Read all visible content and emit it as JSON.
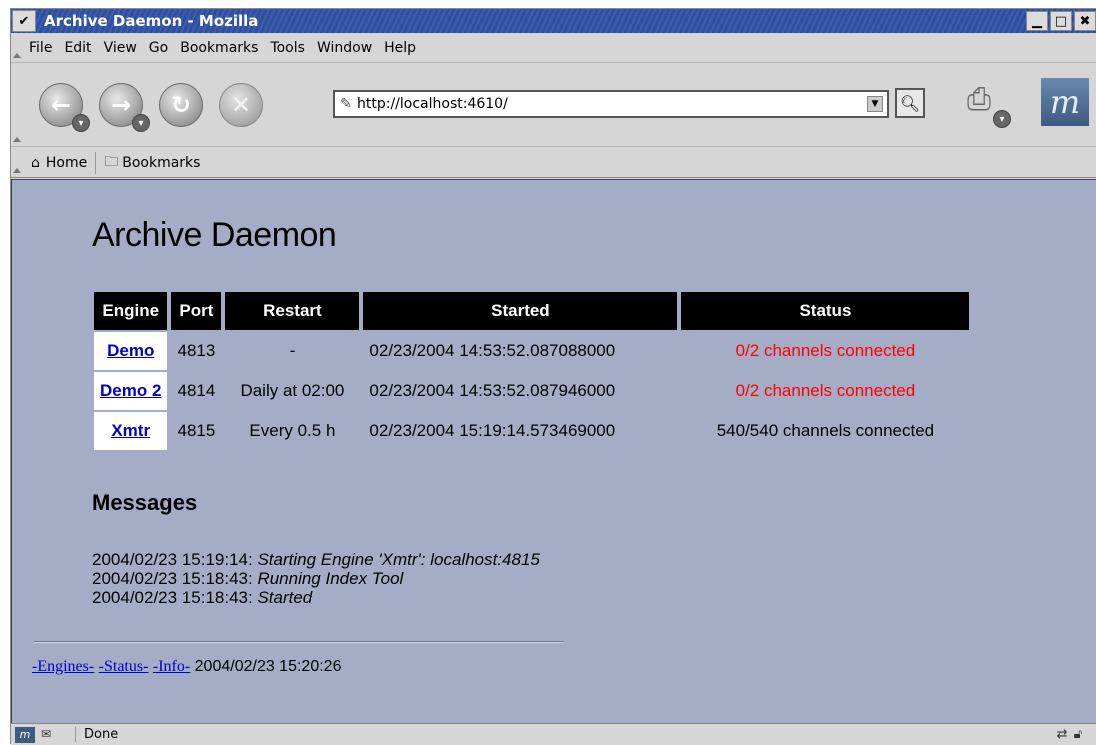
{
  "window": {
    "title": "Archive Daemon - Mozilla",
    "menu_glyph": "✔",
    "min_glyph": "▁",
    "max_glyph": "□",
    "close_glyph": "✖"
  },
  "menubar": [
    "File",
    "Edit",
    "View",
    "Go",
    "Bookmarks",
    "Tools",
    "Window",
    "Help"
  ],
  "navbar": {
    "url": "http://localhost:4610/"
  },
  "persbar": {
    "home": "Home",
    "bookmarks": "Bookmarks"
  },
  "page": {
    "title": "Archive Daemon",
    "table": {
      "headers": [
        "Engine",
        "Port",
        "Restart",
        "Started",
        "Status"
      ],
      "rows": [
        {
          "engine": "Demo",
          "port": "4813",
          "restart": "-",
          "started": "02/23/2004 14:53:52.087088000",
          "status": "0/2 channels connected",
          "status_color": "#ff0000"
        },
        {
          "engine": "Demo 2",
          "port": "4814",
          "restart": "Daily at 02:00",
          "started": "02/23/2004 14:53:52.087946000",
          "status": "0/2 channels connected",
          "status_color": "#ff0000"
        },
        {
          "engine": "Xmtr",
          "port": "4815",
          "restart": "Every 0.5 h",
          "started": "02/23/2004 15:19:14.573469000",
          "status": "540/540 channels connected",
          "status_color": "#000000"
        }
      ]
    },
    "messages_title": "Messages",
    "messages": [
      {
        "time": "2004/02/23 15:19:14:",
        "text": "Starting Engine 'Xmtr': localhost:4815"
      },
      {
        "time": "2004/02/23 15:18:43:",
        "text": "Running Index Tool"
      },
      {
        "time": "2004/02/23 15:18:43:",
        "text": "Started"
      }
    ],
    "footer": {
      "links": [
        "-Engines-",
        "-Status-",
        "-Info-"
      ],
      "timestamp": "2004/02/23 15:20:26"
    }
  },
  "statusbar": {
    "text": "Done"
  }
}
